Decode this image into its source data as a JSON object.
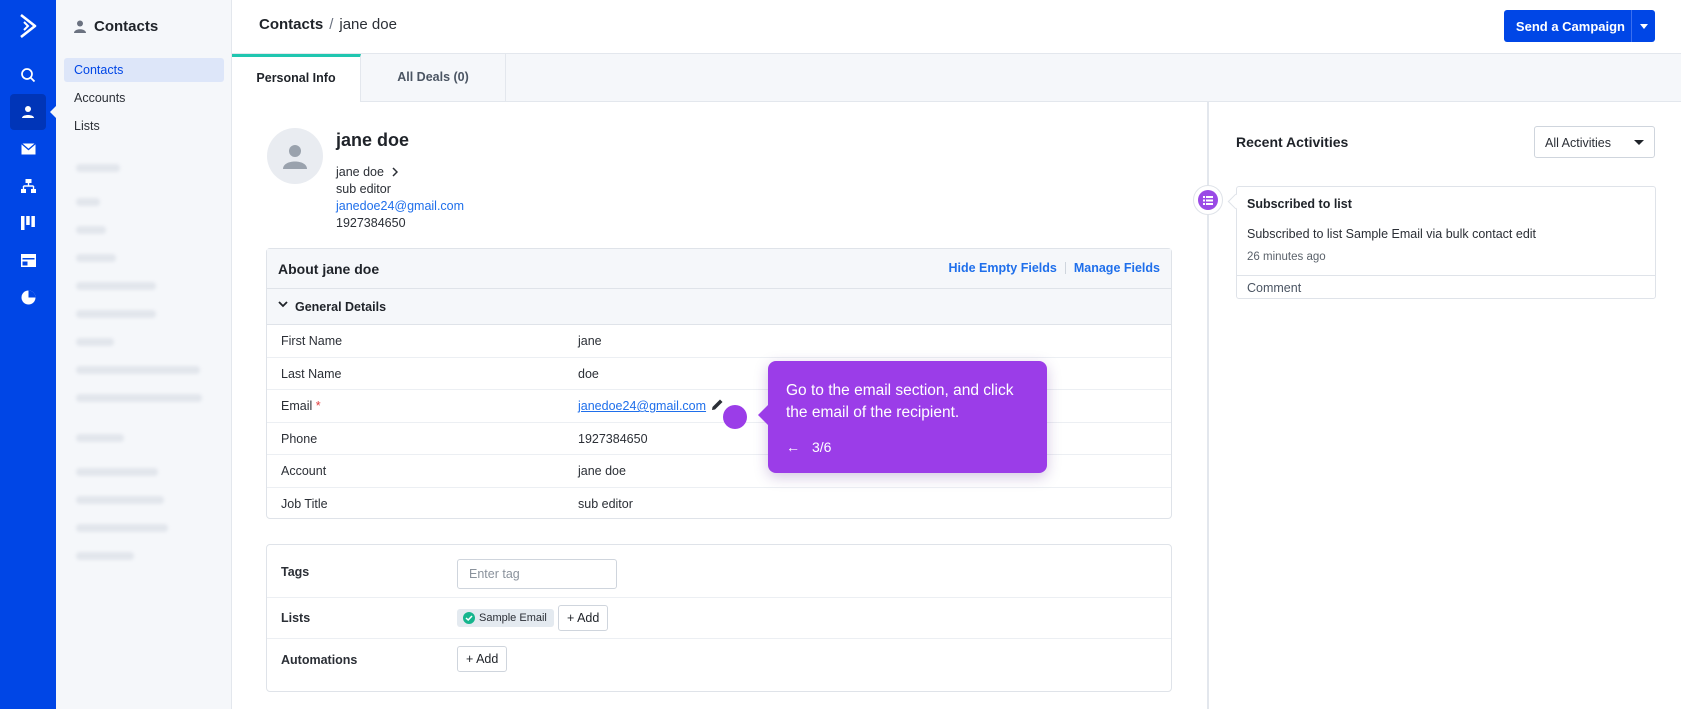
{
  "header": {
    "breadcrumb_root": "Contacts",
    "breadcrumb_sep": "/",
    "breadcrumb_current": "jane doe",
    "send_campaign_label": "Send a Campaign"
  },
  "sidebar": {
    "title": "Contacts",
    "items": [
      {
        "label": "Contacts",
        "active": true
      },
      {
        "label": "Accounts",
        "active": false
      },
      {
        "label": "Lists",
        "active": false
      }
    ]
  },
  "tabs": [
    {
      "label": "Personal Info",
      "active": true
    },
    {
      "label": "All Deals (0)",
      "active": false
    }
  ],
  "contact": {
    "name": "jane doe",
    "account": "jane doe",
    "job_title": "sub editor",
    "email": "janedoe24@gmail.com",
    "phone": "1927384650"
  },
  "about": {
    "title": "About jane doe",
    "hide_empty_label": "Hide Empty Fields",
    "manage_fields_label": "Manage Fields",
    "section_title": "General Details",
    "fields": [
      {
        "label": "First Name",
        "value": "jane"
      },
      {
        "label": "Last Name",
        "value": "doe"
      },
      {
        "label": "Email",
        "value": "janedoe24@gmail.com",
        "required_mark": "*"
      },
      {
        "label": "Phone",
        "value": "1927384650"
      },
      {
        "label": "Account",
        "value": "jane doe"
      },
      {
        "label": "Job Title",
        "value": "sub editor"
      }
    ]
  },
  "meta": {
    "tags_label": "Tags",
    "tag_placeholder": "Enter tag",
    "lists_label": "Lists",
    "list_chip": "Sample Email",
    "add_label": "+ Add",
    "automations_label": "Automations"
  },
  "tooltip": {
    "text": "Go to the email section, and click the email of the recipient.",
    "back_arrow": "←",
    "step": "3/6"
  },
  "activities": {
    "title": "Recent Activities",
    "filter_value": "All Activities",
    "item_title": "Subscribed to list",
    "item_body": "Subscribed to list Sample Email via bulk contact edit",
    "item_time": "26 minutes ago",
    "comment_label": "Comment"
  },
  "colors": {
    "rail": "#0046e6",
    "accent_tab": "#20c6b0",
    "tooltip": "#9b3de8",
    "link": "#1f6feb"
  }
}
